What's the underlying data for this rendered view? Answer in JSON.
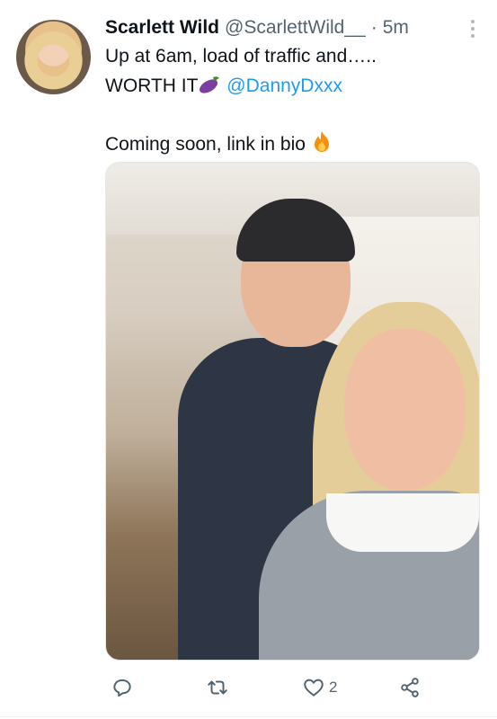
{
  "author": {
    "name": "Scarlett Wild",
    "handle": "@ScarlettWild__",
    "separator": "·",
    "time": "5m"
  },
  "tweet": {
    "line1": "Up at 6am, load of traffic and…..",
    "line2_text": "WORTH IT",
    "line2_mention": "@DannyDxxx",
    "line3": "Coming soon, link in bio"
  },
  "icons": {
    "avatar": "profile-photo",
    "more": "more-icon",
    "emoji1": "eggplant-emoji",
    "emoji2": "fire-emoji",
    "reply": "reply-icon",
    "retweet": "retweet-icon",
    "like": "heart-icon",
    "share": "share-icon"
  },
  "stats": {
    "likes": "2"
  },
  "colors": {
    "text": "#0f1419",
    "secondary": "#536471",
    "link": "#1d9bf0"
  }
}
